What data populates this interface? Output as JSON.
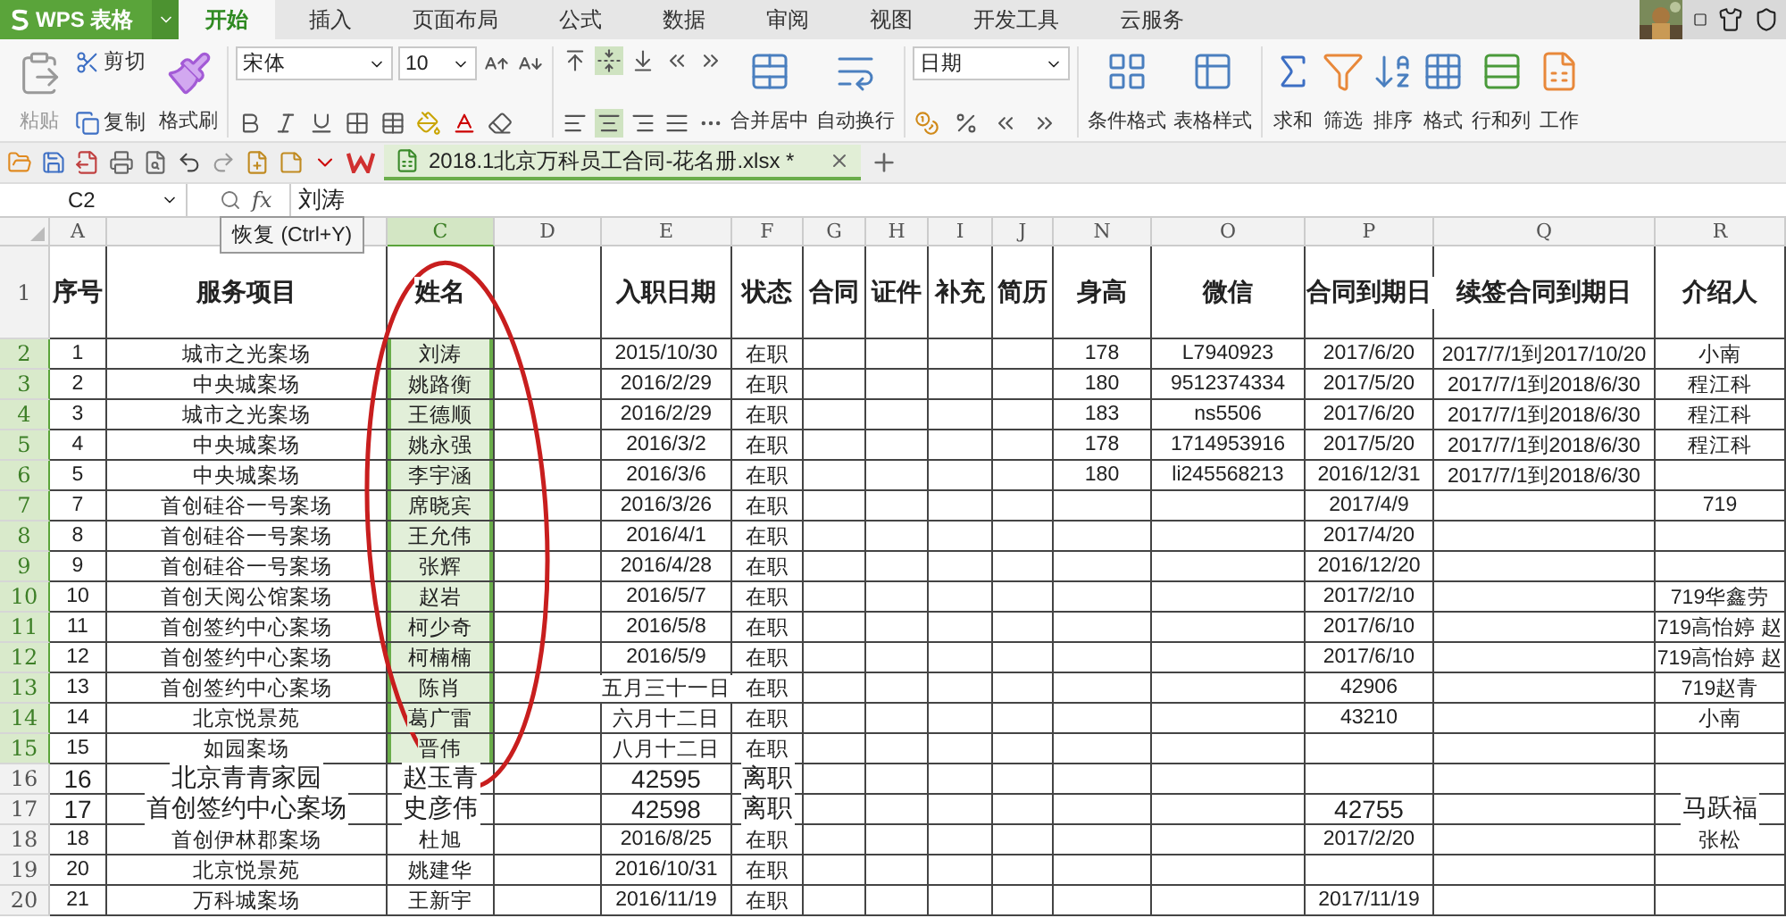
{
  "app": {
    "logo": "WPS 表格"
  },
  "menu_tabs": [
    {
      "label": "开始",
      "selected": true
    },
    {
      "label": "插入",
      "selected": false
    },
    {
      "label": "页面布局",
      "selected": false
    },
    {
      "label": "公式",
      "selected": false
    },
    {
      "label": "数据",
      "selected": false
    },
    {
      "label": "审阅",
      "selected": false
    },
    {
      "label": "视图",
      "selected": false
    },
    {
      "label": "开发工具",
      "selected": false
    },
    {
      "label": "云服务",
      "selected": false
    }
  ],
  "ribbon": {
    "paste": "粘贴",
    "cut": "剪切",
    "copy": "复制",
    "painter": "格式刷",
    "font_family": "宋体",
    "font_size": "10",
    "number_format": "日期",
    "align_tools": [
      {
        "label": "合并居中",
        "kind": "merge"
      },
      {
        "label": "自动换行",
        "kind": "wrap"
      }
    ],
    "style_tools": [
      {
        "label": "条件格式",
        "kind": "conditional"
      },
      {
        "label": "表格样式",
        "kind": "table_style"
      }
    ],
    "edit_tools": [
      {
        "label": "求和",
        "kind": "sum"
      },
      {
        "label": "筛选",
        "kind": "filter"
      },
      {
        "label": "排序",
        "kind": "sort"
      },
      {
        "label": "格式",
        "kind": "format"
      },
      {
        "label": "行和列",
        "kind": "rows_cols"
      },
      {
        "label": "工作",
        "kind": "sheet"
      }
    ]
  },
  "document_tab": {
    "title": "2018.1北京万科员工合同-花名册.xlsx *"
  },
  "formula_bar": {
    "cell": "C2",
    "function_label": "fx",
    "value": "刘涛"
  },
  "tooltip": "恢复 (Ctrl+Y)",
  "columns": [
    {
      "label": "A",
      "selected": false
    },
    {
      "selected": false
    },
    {
      "label": "C",
      "selected": true
    },
    {
      "label": "D",
      "selected": false
    },
    {
      "label": "E",
      "selected": false
    },
    {
      "label": "F",
      "selected": false
    },
    {
      "label": "G",
      "selected": false
    },
    {
      "label": "H",
      "selected": false
    },
    {
      "label": "I",
      "selected": false
    },
    {
      "label": "J",
      "selected": false
    },
    {
      "label": "N",
      "selected": false
    },
    {
      "label": "O",
      "selected": false
    },
    {
      "label": "P",
      "selected": false
    },
    {
      "label": "Q",
      "selected": false
    },
    {
      "label": "R",
      "selected": false
    }
  ],
  "rows": [
    {
      "number": "1",
      "selected": false,
      "kind": "header",
      "cells": [
        "序号",
        "服务项目",
        "姓名",
        "",
        "入职日期",
        "状态",
        "合同",
        "证件",
        "补充",
        "简历",
        "身高",
        "微信",
        "合同到期日",
        "续签合同到期日",
        "介绍人"
      ]
    },
    {
      "number": "2",
      "selected": true,
      "kind": "data",
      "cells": [
        "1",
        "城市之光案场",
        "刘涛",
        "",
        "2015/10/30",
        "在职",
        "",
        "",
        "",
        "",
        "178",
        "L7940923",
        "2017/6/20",
        "2017/7/1到2017/10/20",
        "小南"
      ]
    },
    {
      "number": "3",
      "selected": true,
      "kind": "data",
      "cells": [
        "2",
        "中央城案场",
        "姚路衡",
        "",
        "2016/2/29",
        "在职",
        "",
        "",
        "",
        "",
        "180",
        "9512374334",
        "2017/5/20",
        "2017/7/1到2018/6/30",
        "程江科"
      ]
    },
    {
      "number": "4",
      "selected": true,
      "kind": "data",
      "cells": [
        "3",
        "城市之光案场",
        "王德顺",
        "",
        "2016/2/29",
        "在职",
        "",
        "",
        "",
        "",
        "183",
        "ns5506",
        "2017/6/20",
        "2017/7/1到2018/6/30",
        "程江科"
      ]
    },
    {
      "number": "5",
      "selected": true,
      "kind": "data",
      "cells": [
        "4",
        "中央城案场",
        "姚永强",
        "",
        "2016/3/2",
        "在职",
        "",
        "",
        "",
        "",
        "178",
        "1714953916",
        "2017/5/20",
        "2017/7/1到2018/6/30",
        "程江科"
      ]
    },
    {
      "number": "6",
      "selected": true,
      "kind": "data",
      "cells": [
        "5",
        "中央城案场",
        "李宇涵",
        "",
        "2016/3/6",
        "在职",
        "",
        "",
        "",
        "",
        "180",
        "li245568213",
        "2016/12/31",
        "2017/7/1到2018/6/30",
        ""
      ]
    },
    {
      "number": "7",
      "selected": true,
      "kind": "data",
      "cells": [
        "7",
        "首创硅谷一号案场",
        "席晓宾",
        "",
        "2016/3/26",
        "在职",
        "",
        "",
        "",
        "",
        "",
        "",
        "2017/4/9",
        "",
        "719"
      ]
    },
    {
      "number": "8",
      "selected": true,
      "kind": "data",
      "cells": [
        "8",
        "首创硅谷一号案场",
        "王允伟",
        "",
        "2016/4/1",
        "在职",
        "",
        "",
        "",
        "",
        "",
        "",
        "2017/4/20",
        "",
        ""
      ]
    },
    {
      "number": "9",
      "selected": true,
      "kind": "data",
      "cells": [
        "9",
        "首创硅谷一号案场",
        "张辉",
        "",
        "2016/4/28",
        "在职",
        "",
        "",
        "",
        "",
        "",
        "",
        "2016/12/20",
        "",
        ""
      ]
    },
    {
      "number": "10",
      "selected": true,
      "kind": "data",
      "cells": [
        "10",
        "首创天阅公馆案场",
        "赵岩",
        "",
        "2016/5/7",
        "在职",
        "",
        "",
        "",
        "",
        "",
        "",
        "2017/2/10",
        "",
        "719华鑫劳"
      ]
    },
    {
      "number": "11",
      "selected": true,
      "kind": "data",
      "cells": [
        "11",
        "首创签约中心案场",
        "柯少奇",
        "",
        "2016/5/8",
        "在职",
        "",
        "",
        "",
        "",
        "",
        "",
        "2017/6/10",
        "",
        "719高怡婷 赵"
      ]
    },
    {
      "number": "12",
      "selected": true,
      "kind": "data",
      "cells": [
        "12",
        "首创签约中心案场",
        "柯楠楠",
        "",
        "2016/5/9",
        "在职",
        "",
        "",
        "",
        "",
        "",
        "",
        "2017/6/10",
        "",
        "719高怡婷 赵"
      ]
    },
    {
      "number": "13",
      "selected": true,
      "kind": "data",
      "cells": [
        "13",
        "首创签约中心案场",
        "陈肖",
        "",
        "五月三十一日",
        "在职",
        "",
        "",
        "",
        "",
        "",
        "",
        "42906",
        "",
        "719赵青"
      ]
    },
    {
      "number": "14",
      "selected": true,
      "kind": "data",
      "cells": [
        "14",
        "北京悦景苑",
        "葛广雷",
        "",
        "六月十二日",
        "在职",
        "",
        "",
        "",
        "",
        "",
        "",
        "43210",
        "",
        "小南"
      ]
    },
    {
      "number": "15",
      "selected": true,
      "kind": "data",
      "cells": [
        "15",
        "如园案场",
        "晋伟",
        "",
        "八月十二日",
        "在职",
        "",
        "",
        "",
        "",
        "",
        "",
        "",
        "",
        ""
      ]
    },
    {
      "number": "16",
      "selected": false,
      "kind": "large",
      "cells": [
        "16",
        "北京青青家园",
        "赵玉青",
        "",
        "42595",
        "离职",
        "",
        "",
        "",
        "",
        "",
        "",
        "",
        "",
        ""
      ]
    },
    {
      "number": "17",
      "selected": false,
      "kind": "large",
      "cells": [
        "17",
        "首创签约中心案场",
        "史彦伟",
        "",
        "42598",
        "离职",
        "",
        "",
        "",
        "",
        "",
        "",
        "42755",
        "",
        "马跃福"
      ]
    },
    {
      "number": "18",
      "selected": false,
      "kind": "data",
      "cells": [
        "18",
        "首创伊林郡案场",
        "杜旭",
        "",
        "2016/8/25",
        "在职",
        "",
        "",
        "",
        "",
        "",
        "",
        "2017/2/20",
        "",
        "张松"
      ]
    },
    {
      "number": "19",
      "selected": false,
      "kind": "data",
      "cells": [
        "20",
        "北京悦景苑",
        "姚建华",
        "",
        "2016/10/31",
        "在职",
        "",
        "",
        "",
        "",
        "",
        "",
        "",
        "",
        ""
      ]
    },
    {
      "number": "20",
      "selected": false,
      "kind": "data",
      "cells": [
        "21",
        "万科城案场",
        "王新宇",
        "",
        "2016/11/19",
        "在职",
        "",
        "",
        "",
        "",
        "",
        "",
        "2017/11/19",
        "",
        ""
      ]
    }
  ]
}
